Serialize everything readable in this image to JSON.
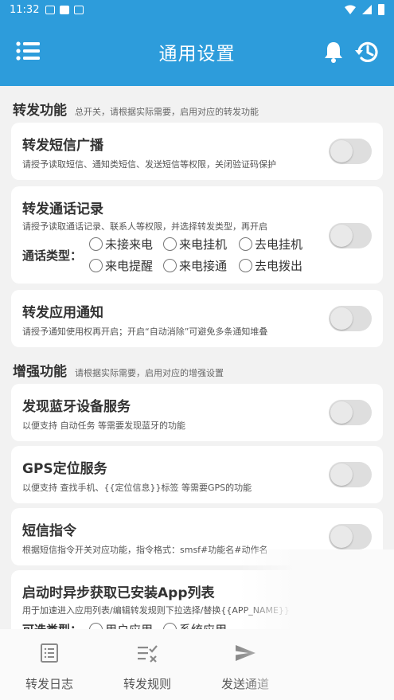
{
  "status_bar": {
    "time": "11:32"
  },
  "app_bar": {
    "title": "通用设置"
  },
  "sections": {
    "forward": {
      "title": "转发功能",
      "desc": "总开关，请根据实际需要，启用对应的转发功能"
    },
    "enhance": {
      "title": "增强功能",
      "desc": "请根据实际需要，启用对应的增强设置"
    }
  },
  "cards": {
    "sms": {
      "title": "转发短信广播",
      "desc": "请授予读取短信、通知类短信、发送短信等权限，关闭验证码保护",
      "enabled": false
    },
    "call": {
      "title": "转发通话记录",
      "desc": "请授予读取通话记录、联系人等权限，并选择转发类型，再开启",
      "type_label": "通话类型：",
      "options": [
        "未接来电",
        "来电挂机",
        "去电挂机",
        "来电提醒",
        "来电接通",
        "去电拨出"
      ],
      "enabled": false
    },
    "app_notify": {
      "title": "转发应用通知",
      "desc": "请授予通知使用权再开启；开启“自动消除”可避免多条通知堆叠",
      "enabled": false
    },
    "bluetooth": {
      "title": "发现蓝牙设备服务",
      "desc": "以便支持 自动任务 等需要发现蓝牙的功能",
      "enabled": false
    },
    "gps": {
      "title": "GPS定位服务",
      "desc": "以便支持 查找手机、{{定位信息}}标签 等需要GPS的功能",
      "enabled": false
    },
    "sms_cmd": {
      "title": "短信指令",
      "desc": "根据短信指令开关对应功能，指令格式：smsf#功能名#动作名",
      "enabled": false
    },
    "app_list": {
      "title": "启动时异步获取已安装App列表",
      "desc": "用于加速进入应用列表/编辑转发规则下拉选择/替换{{APP_NAME}}",
      "type_label": "可选类型：",
      "options": [
        "用户应用",
        "系统应用"
      ],
      "enabled": false
    }
  },
  "bottom_nav": {
    "items": [
      {
        "label": "转发日志",
        "icon": "log-list-icon"
      },
      {
        "label": "转发规则",
        "icon": "rule-check-icon"
      },
      {
        "label": "发送通道",
        "icon": "send-icon"
      }
    ]
  },
  "colors": {
    "primary": "#2d9cdb",
    "background": "#f2f2f2"
  }
}
